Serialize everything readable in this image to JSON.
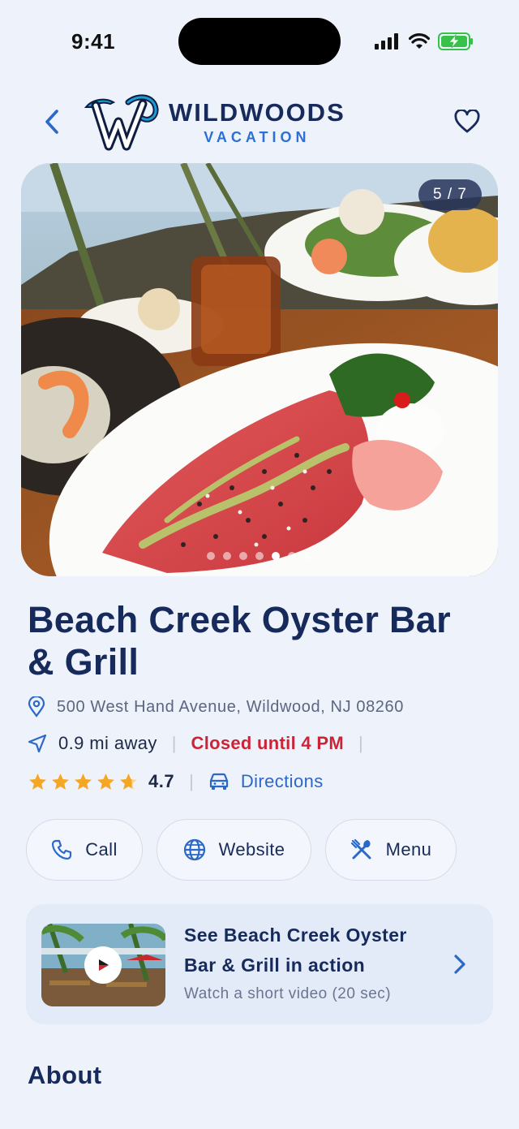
{
  "status_bar": {
    "time": "9:41"
  },
  "header": {
    "brand_title": "WILDWOODS",
    "brand_subtitle": "VACATION"
  },
  "gallery": {
    "counter": "5 / 7",
    "current": 5,
    "total": 7
  },
  "place": {
    "name": "Beach Creek Oyster Bar & Grill",
    "address": "500 West Hand Avenue, Wildwood, NJ 08260",
    "distance": "0.9 mi away",
    "status": "Closed until 4 PM",
    "rating": "4.7",
    "rating_value": 4.7,
    "directions_label": "Directions"
  },
  "actions": {
    "call": "Call",
    "website": "Website",
    "menu": "Menu"
  },
  "video": {
    "title": "See Beach Creek Oyster Bar & Grill in action",
    "subtitle": "Watch a short video (20 sec)"
  },
  "sections": {
    "about": "About"
  },
  "colors": {
    "brand_navy": "#172a5c",
    "accent_blue": "#2b68c8",
    "closed_red": "#cc2437",
    "star": "#f5a623",
    "background": "#eef2fa"
  },
  "icons": {
    "back": "chevron-left-icon",
    "favorite": "heart-outline-icon",
    "location": "map-pin-icon",
    "distance": "navigation-arrow-icon",
    "directions": "car-icon",
    "call": "phone-icon",
    "website": "globe-icon",
    "menu": "utensils-icon",
    "play": "play-icon",
    "open": "chevron-right-icon"
  }
}
